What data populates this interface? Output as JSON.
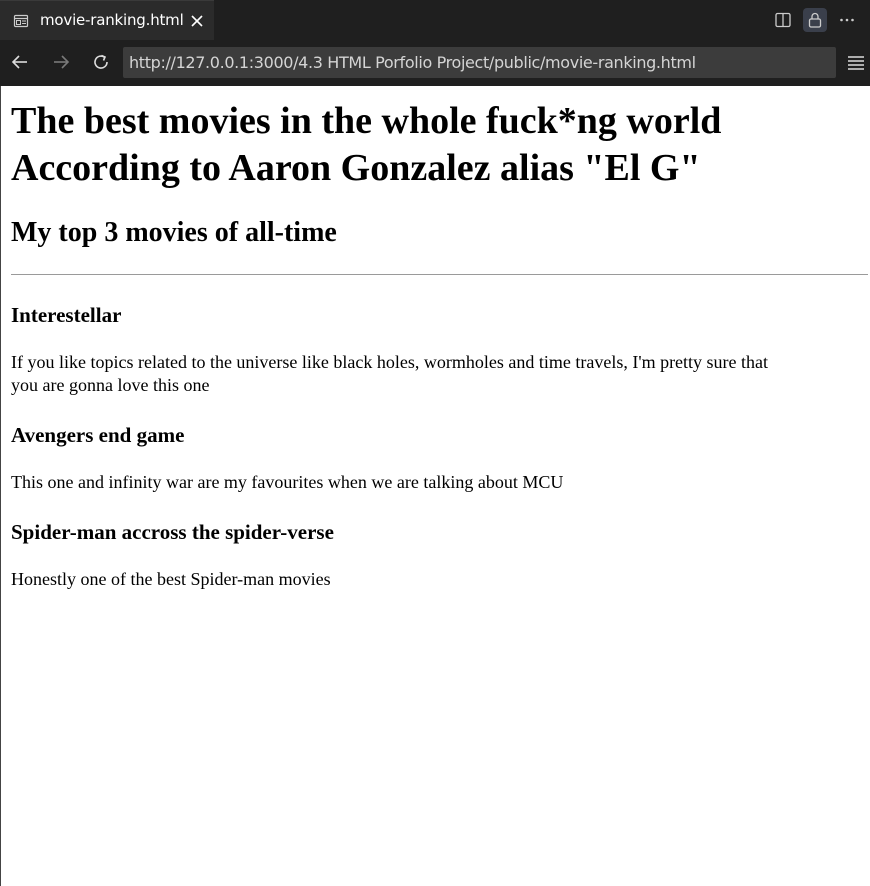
{
  "browser": {
    "tab": {
      "title": "movie-ranking.html",
      "icon": "page-preview-icon"
    },
    "window_buttons": [
      "split-editor-icon",
      "lock-icon",
      "more-icon"
    ],
    "nav": {
      "back": "back-arrow-icon",
      "forward": "forward-arrow-icon",
      "reload": "reload-icon"
    },
    "url": "http://127.0.0.1:3000/4.3 HTML Porfolio Project/public/movie-ranking.html",
    "menu_icon": "hamburger-menu-icon"
  },
  "page": {
    "title_line1": "The best movies in the whole fuck*ng world",
    "title_line2": "According to Aaron Gonzalez alias \"El G\"",
    "subtitle": "My top 3 movies of all-time",
    "movies": [
      {
        "name": "Interestellar",
        "description_line1": "If you like topics related to the universe like black holes, wormholes and time travels, I'm pretty sure that",
        "description_line2": "you are gonna love this one"
      },
      {
        "name": "Avengers end game",
        "description_line1": "This one and infinity war are my favourites when we are talking about MCU",
        "description_line2": ""
      },
      {
        "name": "Spider-man accross the spider-verse",
        "description_line1": "Honestly one of the best Spider-man movies",
        "description_line2": ""
      }
    ]
  },
  "colors": {
    "chrome_bg": "#1f1f1f",
    "tab_bg": "#2b2b2b",
    "url_bg": "#3c3c3c",
    "page_bg": "#ffffff",
    "text": "#000000"
  }
}
